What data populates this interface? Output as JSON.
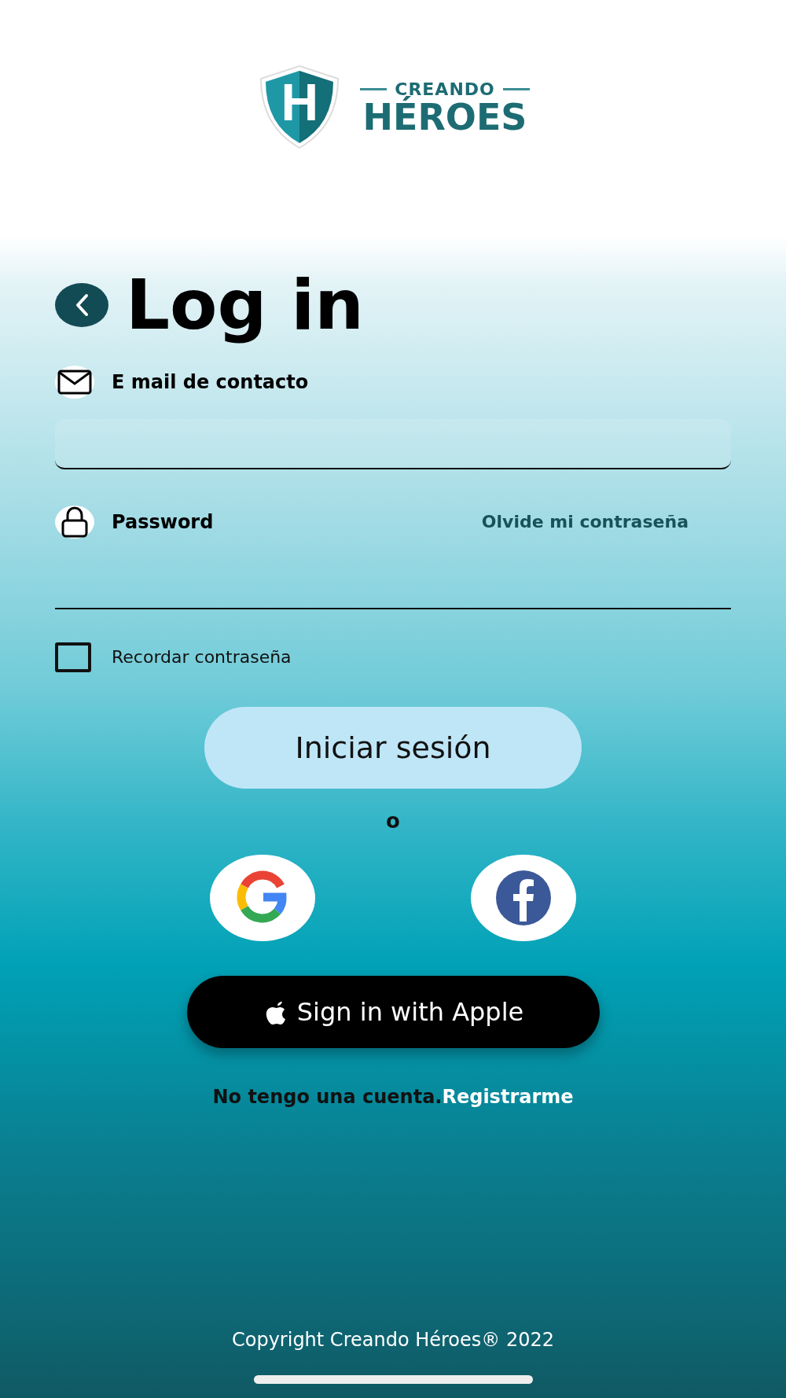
{
  "logo": {
    "mark": "H",
    "top_line": "CREANDO",
    "name": "HÉROES"
  },
  "title": "Log in",
  "email": {
    "label": "E mail de contacto"
  },
  "password": {
    "label": "Password",
    "forgot_link": "Olvide mi contraseña"
  },
  "remember": {
    "label": "Recordar contraseña",
    "checked": false
  },
  "login_button": "Iniciar sesión",
  "separator": "o",
  "social_buttons": [
    {
      "kind": "google"
    },
    {
      "kind": "facebook"
    }
  ],
  "apple_button": "Sign in with Apple",
  "register": {
    "text": "No tengo una cuenta.",
    "link": "Registrarme"
  },
  "copyright": "Copyright Creando Héroes® 2022"
}
